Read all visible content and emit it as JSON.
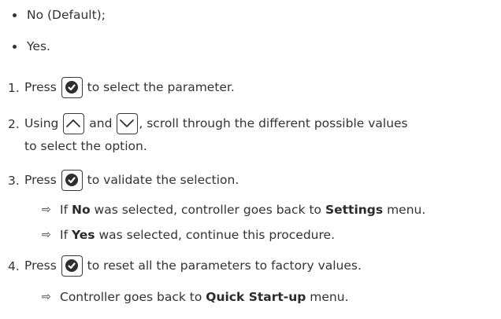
{
  "options": [
    {
      "text": "No (Default);"
    },
    {
      "text": "Yes."
    }
  ],
  "steps": [
    {
      "num": "1.",
      "pre": "Press",
      "post": "to select the parameter."
    },
    {
      "num": "2.",
      "pre": "Using",
      "mid": "and",
      "post": ", scroll through the different possible values",
      "post2": "to select the option."
    },
    {
      "num": "3.",
      "pre": "Press",
      "post": "to validate the selection."
    },
    {
      "num": "4.",
      "pre": "Press",
      "post": "to reset all the parameters to factory values."
    }
  ],
  "results": {
    "r1": {
      "pre": "If ",
      "bold1": "No",
      "mid": " was selected, controller goes back to ",
      "bold2": "Settings",
      "post": " menu."
    },
    "r2": {
      "pre": "If ",
      "bold1": "Yes",
      "post": " was selected, continue this procedure."
    },
    "r3": {
      "pre": "Controller goes back to ",
      "bold1": "Quick Start-up",
      "post": " menu."
    }
  },
  "arrow_glyph": "⇨",
  "icons": [
    "ok-check-icon",
    "up-arrow-key-icon",
    "down-arrow-key-icon"
  ]
}
